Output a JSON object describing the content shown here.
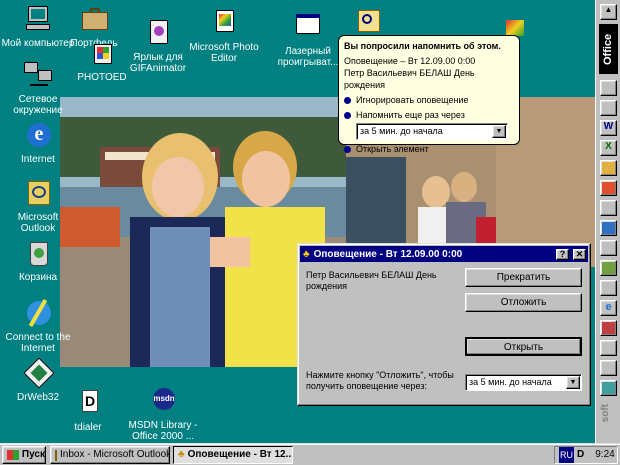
{
  "desktop": {
    "icons": [
      {
        "label": "Мой компьютер"
      },
      {
        "label": "Сетевое окружение"
      },
      {
        "label": "Internet"
      },
      {
        "label": "Microsoft Outlook"
      },
      {
        "label": "Корзина"
      },
      {
        "label": "Connect to the Internet"
      },
      {
        "label": "DrWeb32"
      },
      {
        "label": "Портфель"
      },
      {
        "label": "PHOTOED"
      },
      {
        "label": "Ярлык для GIFAnimator"
      },
      {
        "label": "Microsoft Photo Editor"
      },
      {
        "label": "Лазерный проигрыват..."
      },
      {
        "label": "tdialer"
      },
      {
        "label": "MSDN Library - Office 2000 ..."
      }
    ]
  },
  "balloon": {
    "heading": "Вы попросили напомнить об этом.",
    "line1": "Оповещение – Вт 12.09.00 0:00",
    "line2": "Петр Васильевич БЕЛАШ День рождения",
    "option1": "Игнорировать оповещение",
    "option2": "Напомнить еще раз через",
    "combo_value": "за 5 мин. до начала",
    "option3": "Открыть элемент"
  },
  "dialog": {
    "title": "Оповещение - Вт 12.09.00 0:00",
    "help": "?",
    "close": "✕",
    "subject": "Петр Васильевич БЕЛАШ День рождения",
    "dismiss": "Прекратить",
    "postpone": "Отложить",
    "open": "Открыть",
    "prompt": "Нажмите кнопку \"Отложить\", чтобы получить оповещение через:",
    "combo_value": "за 5 мин. до начала"
  },
  "taskbar": {
    "start": "Пуск",
    "tasks": [
      "Inbox - Microsoft Outlook",
      "Оповещение - Вт 12..."
    ],
    "lang": "RU",
    "clock": "9:24"
  },
  "officebar": {
    "label": "Office",
    "bottom": "soft"
  },
  "colors": {
    "desktop": "#008080",
    "title_active": "#000080",
    "balloon": "#ffffe1"
  }
}
